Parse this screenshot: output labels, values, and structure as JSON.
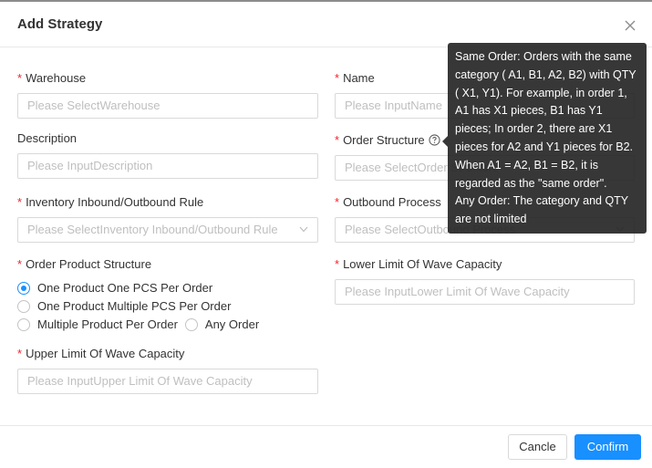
{
  "dialog": {
    "title": "Add Strategy"
  },
  "fields": {
    "warehouse": {
      "label": "Warehouse",
      "required": "*",
      "placeholder": "Please SelectWarehouse"
    },
    "name": {
      "label": "Name",
      "required": "*",
      "placeholder": "Please InputName"
    },
    "description": {
      "label": "Description",
      "placeholder": "Please InputDescription"
    },
    "order_structure": {
      "label": "Order Structure",
      "required": "*",
      "placeholder": "Please SelectOrder Structure"
    },
    "inventory_rule": {
      "label": "Inventory Inbound/Outbound Rule",
      "required": "*",
      "placeholder": "Please SelectInventory Inbound/Outbound Rule"
    },
    "outbound_process": {
      "label": "Outbound Process",
      "required": "*",
      "placeholder": "Please SelectOutbound Process"
    },
    "order_product_structure": {
      "label": "Order Product Structure",
      "required": "*",
      "options": [
        {
          "label": "One Product One PCS Per Order",
          "selected": true
        },
        {
          "label": "One Product Multiple PCS Per Order",
          "selected": false
        },
        {
          "label": "Multiple Product Per Order",
          "selected": false
        },
        {
          "label": "Any Order",
          "selected": false
        }
      ]
    },
    "lower_limit": {
      "label": "Lower Limit Of Wave Capacity",
      "required": "*",
      "placeholder": "Please InputLower Limit Of Wave Capacity"
    },
    "upper_limit": {
      "label": "Upper Limit Of Wave Capacity",
      "required": "*",
      "placeholder": "Please InputUpper Limit Of Wave Capacity"
    }
  },
  "tooltip": {
    "same_order": "Same Order: Orders with the same category ( A1, B1, A2, B2) with QTY ( X1, Y1). For example, in order 1, A1 has X1 pieces, B1 has Y1 pieces; In order 2, there are X1 pieces for A2 and Y1 pieces for B2. When A1 = A2, B1 = B2, it is regarded as the \"same order\".",
    "any_order": "Any Order: The category and QTY are not limited"
  },
  "footer": {
    "cancel_label": "Cancle",
    "confirm_label": "Confirm"
  },
  "icons": {
    "close": "close-icon",
    "help": "question-circle-icon",
    "caret": "chevron-down-icon"
  },
  "colors": {
    "primary": "#1890ff",
    "required": "#f5222d",
    "tooltip_bg": "#262626"
  }
}
